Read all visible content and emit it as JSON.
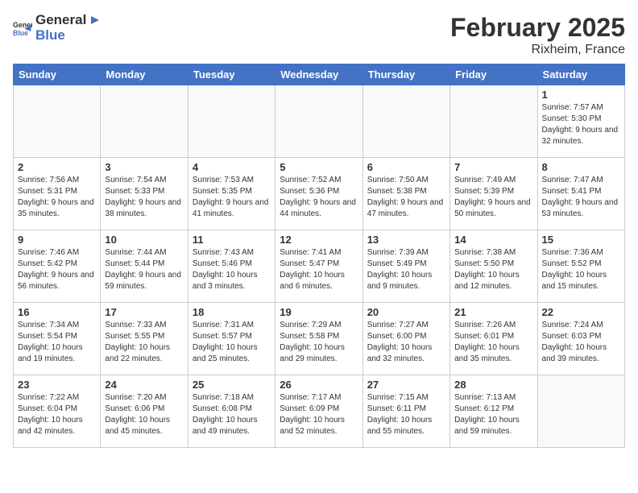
{
  "header": {
    "logo_general": "General",
    "logo_blue": "Blue",
    "title": "February 2025",
    "subtitle": "Rixheim, France"
  },
  "weekdays": [
    "Sunday",
    "Monday",
    "Tuesday",
    "Wednesday",
    "Thursday",
    "Friday",
    "Saturday"
  ],
  "weeks": [
    [
      {
        "day": "",
        "info": ""
      },
      {
        "day": "",
        "info": ""
      },
      {
        "day": "",
        "info": ""
      },
      {
        "day": "",
        "info": ""
      },
      {
        "day": "",
        "info": ""
      },
      {
        "day": "",
        "info": ""
      },
      {
        "day": "1",
        "info": "Sunrise: 7:57 AM\nSunset: 5:30 PM\nDaylight: 9 hours and 32 minutes."
      }
    ],
    [
      {
        "day": "2",
        "info": "Sunrise: 7:56 AM\nSunset: 5:31 PM\nDaylight: 9 hours and 35 minutes."
      },
      {
        "day": "3",
        "info": "Sunrise: 7:54 AM\nSunset: 5:33 PM\nDaylight: 9 hours and 38 minutes."
      },
      {
        "day": "4",
        "info": "Sunrise: 7:53 AM\nSunset: 5:35 PM\nDaylight: 9 hours and 41 minutes."
      },
      {
        "day": "5",
        "info": "Sunrise: 7:52 AM\nSunset: 5:36 PM\nDaylight: 9 hours and 44 minutes."
      },
      {
        "day": "6",
        "info": "Sunrise: 7:50 AM\nSunset: 5:38 PM\nDaylight: 9 hours and 47 minutes."
      },
      {
        "day": "7",
        "info": "Sunrise: 7:49 AM\nSunset: 5:39 PM\nDaylight: 9 hours and 50 minutes."
      },
      {
        "day": "8",
        "info": "Sunrise: 7:47 AM\nSunset: 5:41 PM\nDaylight: 9 hours and 53 minutes."
      }
    ],
    [
      {
        "day": "9",
        "info": "Sunrise: 7:46 AM\nSunset: 5:42 PM\nDaylight: 9 hours and 56 minutes."
      },
      {
        "day": "10",
        "info": "Sunrise: 7:44 AM\nSunset: 5:44 PM\nDaylight: 9 hours and 59 minutes."
      },
      {
        "day": "11",
        "info": "Sunrise: 7:43 AM\nSunset: 5:46 PM\nDaylight: 10 hours and 3 minutes."
      },
      {
        "day": "12",
        "info": "Sunrise: 7:41 AM\nSunset: 5:47 PM\nDaylight: 10 hours and 6 minutes."
      },
      {
        "day": "13",
        "info": "Sunrise: 7:39 AM\nSunset: 5:49 PM\nDaylight: 10 hours and 9 minutes."
      },
      {
        "day": "14",
        "info": "Sunrise: 7:38 AM\nSunset: 5:50 PM\nDaylight: 10 hours and 12 minutes."
      },
      {
        "day": "15",
        "info": "Sunrise: 7:36 AM\nSunset: 5:52 PM\nDaylight: 10 hours and 15 minutes."
      }
    ],
    [
      {
        "day": "16",
        "info": "Sunrise: 7:34 AM\nSunset: 5:54 PM\nDaylight: 10 hours and 19 minutes."
      },
      {
        "day": "17",
        "info": "Sunrise: 7:33 AM\nSunset: 5:55 PM\nDaylight: 10 hours and 22 minutes."
      },
      {
        "day": "18",
        "info": "Sunrise: 7:31 AM\nSunset: 5:57 PM\nDaylight: 10 hours and 25 minutes."
      },
      {
        "day": "19",
        "info": "Sunrise: 7:29 AM\nSunset: 5:58 PM\nDaylight: 10 hours and 29 minutes."
      },
      {
        "day": "20",
        "info": "Sunrise: 7:27 AM\nSunset: 6:00 PM\nDaylight: 10 hours and 32 minutes."
      },
      {
        "day": "21",
        "info": "Sunrise: 7:26 AM\nSunset: 6:01 PM\nDaylight: 10 hours and 35 minutes."
      },
      {
        "day": "22",
        "info": "Sunrise: 7:24 AM\nSunset: 6:03 PM\nDaylight: 10 hours and 39 minutes."
      }
    ],
    [
      {
        "day": "23",
        "info": "Sunrise: 7:22 AM\nSunset: 6:04 PM\nDaylight: 10 hours and 42 minutes."
      },
      {
        "day": "24",
        "info": "Sunrise: 7:20 AM\nSunset: 6:06 PM\nDaylight: 10 hours and 45 minutes."
      },
      {
        "day": "25",
        "info": "Sunrise: 7:18 AM\nSunset: 6:08 PM\nDaylight: 10 hours and 49 minutes."
      },
      {
        "day": "26",
        "info": "Sunrise: 7:17 AM\nSunset: 6:09 PM\nDaylight: 10 hours and 52 minutes."
      },
      {
        "day": "27",
        "info": "Sunrise: 7:15 AM\nSunset: 6:11 PM\nDaylight: 10 hours and 55 minutes."
      },
      {
        "day": "28",
        "info": "Sunrise: 7:13 AM\nSunset: 6:12 PM\nDaylight: 10 hours and 59 minutes."
      },
      {
        "day": "",
        "info": ""
      }
    ]
  ]
}
